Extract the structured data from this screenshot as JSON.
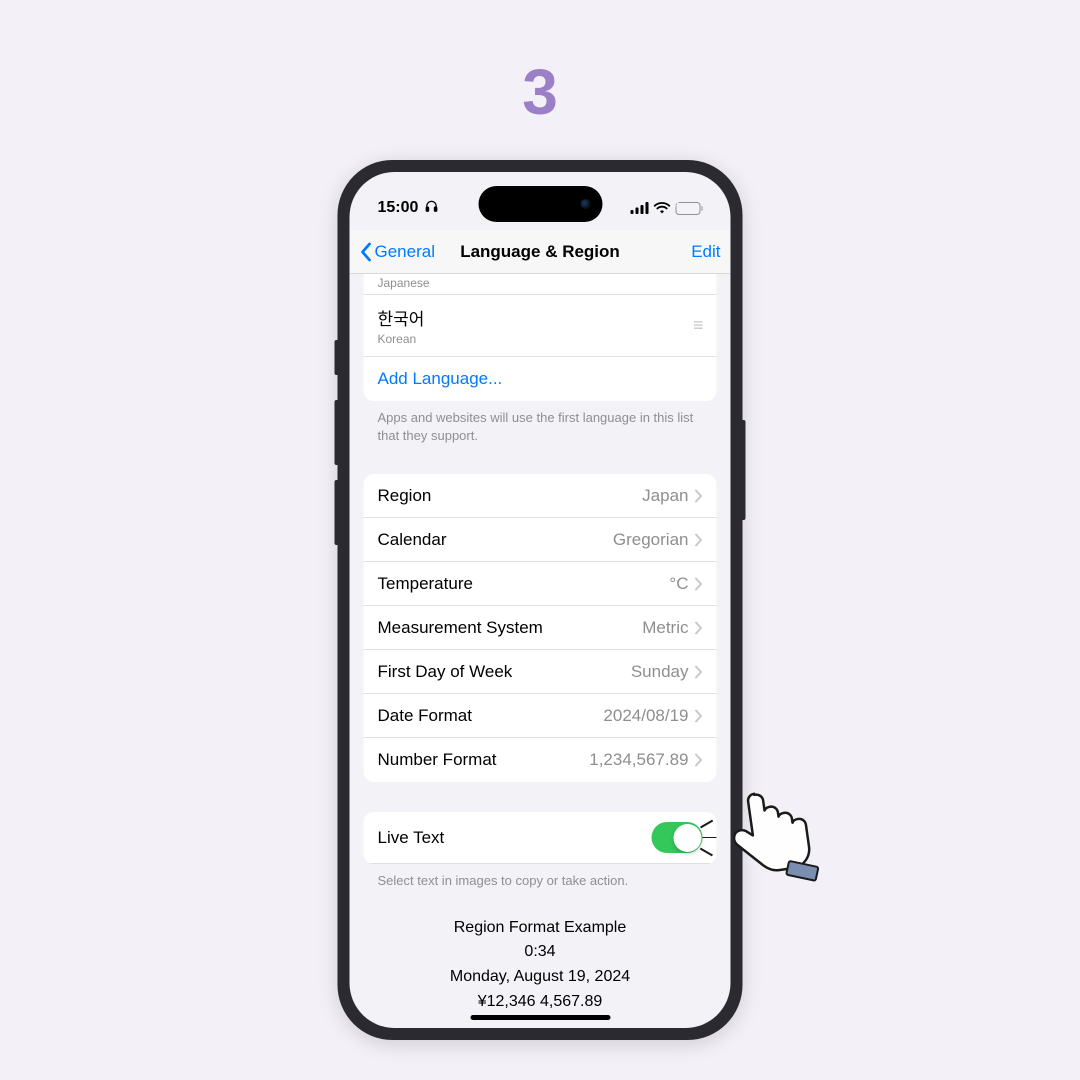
{
  "step": "3",
  "status": {
    "time": "15:00",
    "headphones_icon": "headphones-icon"
  },
  "nav": {
    "back": "General",
    "title": "Language & Region",
    "edit": "Edit"
  },
  "languages": {
    "partial_sub": "Japanese",
    "korean_native": "한국어",
    "korean_sub": "Korean",
    "add": "Add Language...",
    "footer": "Apps and websites will use the first language in this list that they support."
  },
  "settings": [
    {
      "label": "Region",
      "value": "Japan"
    },
    {
      "label": "Calendar",
      "value": "Gregorian"
    },
    {
      "label": "Temperature",
      "value": "°C"
    },
    {
      "label": "Measurement System",
      "value": "Metric"
    },
    {
      "label": "First Day of Week",
      "value": "Sunday"
    },
    {
      "label": "Date Format",
      "value": "2024/08/19"
    },
    {
      "label": "Number Format",
      "value": "1,234,567.89"
    }
  ],
  "live_text": {
    "label": "Live Text",
    "footer": "Select text in images to copy or take action.",
    "enabled": true
  },
  "example": {
    "title": "Region Format Example",
    "time": "0:34",
    "date": "Monday, August 19, 2024",
    "currency": "¥12,346   4,567.89"
  },
  "colors": {
    "accent": "#007aff",
    "toggle_on": "#34c759",
    "highlight": "#ff2d2d",
    "step": "#9b7fc7"
  }
}
